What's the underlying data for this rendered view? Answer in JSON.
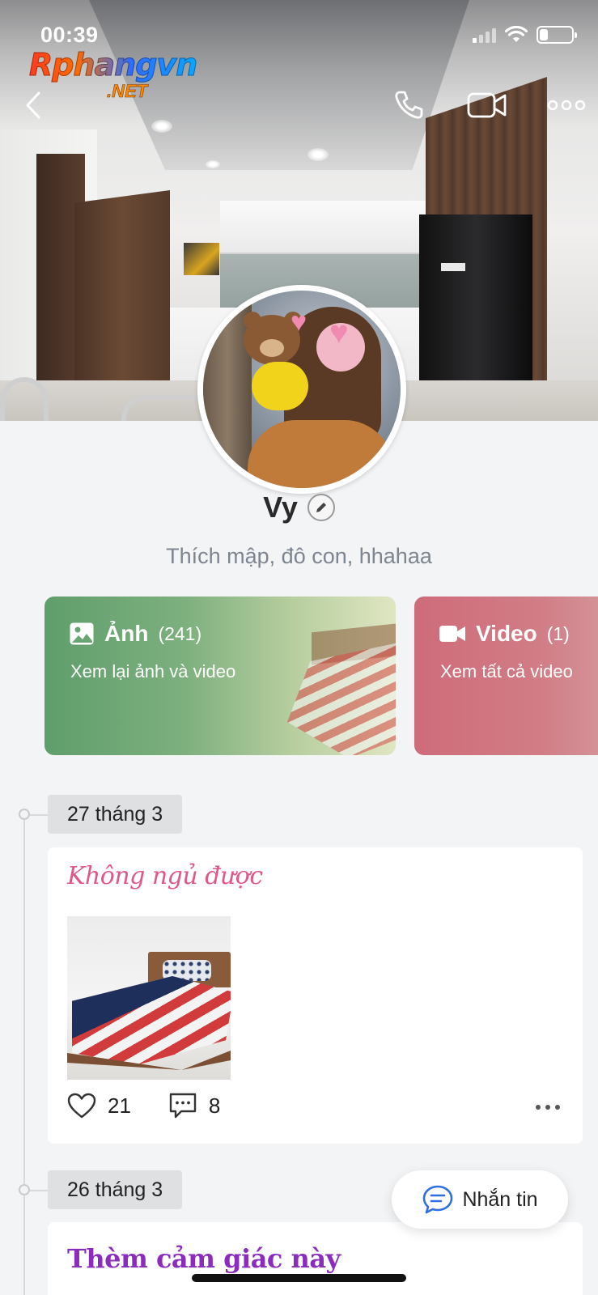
{
  "status_bar": {
    "time": "00:39",
    "signal_bars": 1,
    "battery_level": 0.25
  },
  "watermark": {
    "main": "Rphangvn",
    "sub": ".NET"
  },
  "nav": {
    "back_icon": "chevron-left-icon",
    "call_icon": "phone-icon",
    "video_call_icon": "video-camera-icon",
    "more_icon": "more-horizontal-icon"
  },
  "profile": {
    "name": "Vy",
    "bio": "Thích mập, đô con, hhahaa"
  },
  "media_cards": {
    "photos": {
      "label": "Ảnh",
      "count": "(241)",
      "subtitle": "Xem lại ảnh và video",
      "icon": "image-icon",
      "color": "#6aa473"
    },
    "videos": {
      "label": "Video",
      "count": "(1)",
      "subtitle": "Xem tất cả video",
      "icon": "video-icon",
      "color": "#cf6b7a"
    }
  },
  "timeline": [
    {
      "date": "27 tháng 3",
      "title": "Không ngủ được",
      "title_color": "#e0578a",
      "likes": "21",
      "comments": "8"
    },
    {
      "date": "26 tháng 3",
      "title": "Thèm cảm giác này",
      "title_color": "#8a2dbd"
    }
  ],
  "message_button": {
    "label": "Nhắn tin",
    "icon": "chat-bubble-icon",
    "accent": "#2f6fe0"
  }
}
